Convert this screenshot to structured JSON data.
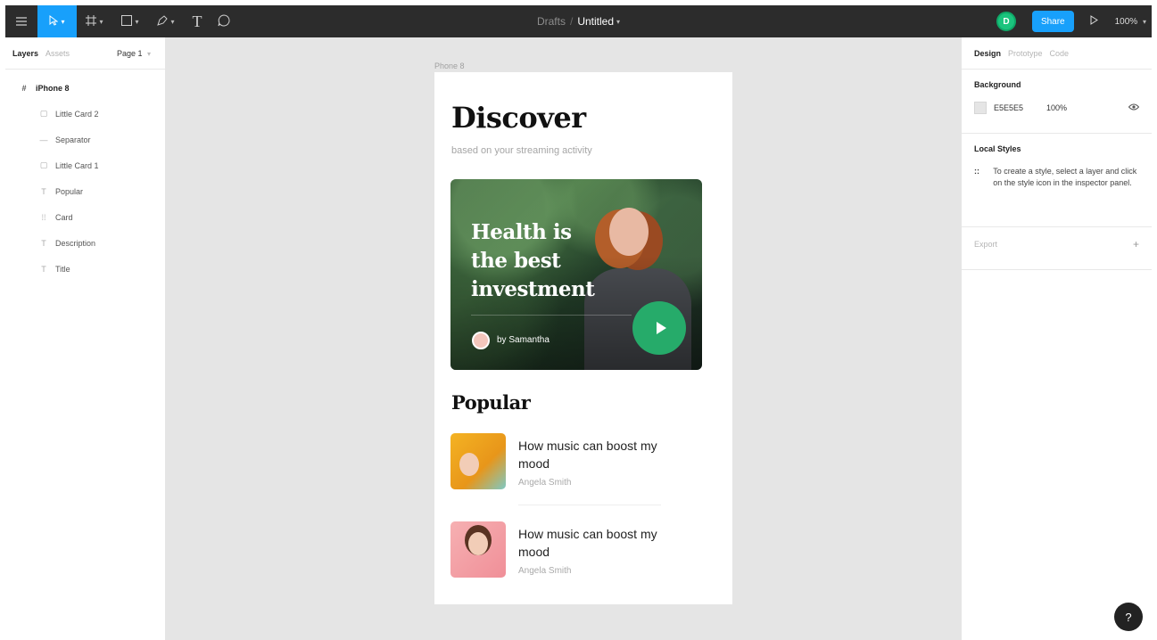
{
  "toolbar": {
    "icons": [
      "menu-icon",
      "move-icon",
      "frame-icon",
      "shape-icon",
      "pen-icon",
      "text-icon",
      "comment-icon"
    ],
    "text_tool_glyph": "T",
    "breadcrumb": {
      "project": "Drafts",
      "separator": "/",
      "file": "Untitled"
    },
    "avatar_initial": "D",
    "share_label": "Share",
    "zoom_label": "100%",
    "accent": "#18a0fb"
  },
  "left_panel": {
    "tabs": {
      "layers": "Layers",
      "assets": "Assets"
    },
    "page_label": "Page 1",
    "root_layer": "iPhone 8",
    "layers": [
      {
        "label": "Little Card 2",
        "icon": "frame-icon"
      },
      {
        "label": "Separator",
        "icon": "line-icon"
      },
      {
        "label": "Little Card 1",
        "icon": "frame-icon"
      },
      {
        "label": "Popular",
        "icon": "text-icon"
      },
      {
        "label": "Card",
        "icon": "grid-icon"
      },
      {
        "label": "Description",
        "icon": "text-icon"
      },
      {
        "label": "Title",
        "icon": "text-icon"
      }
    ]
  },
  "canvas": {
    "background": "#e5e5e5",
    "frame_label": "Phone 8",
    "screen": {
      "title": "Discover",
      "subtitle": "based on your streaming activity",
      "hero": {
        "title": "Health is the best investment",
        "author": "by Samantha",
        "play_color": "#26ab6a"
      },
      "popular_heading": "Popular",
      "cards": [
        {
          "title": "How music can boost my mood",
          "author": "Angela Smith"
        },
        {
          "title": "How music can boost my mood",
          "author": "Angela Smith"
        }
      ]
    }
  },
  "right_panel": {
    "tabs": {
      "design": "Design",
      "prototype": "Prototype",
      "code": "Code"
    },
    "background_heading": "Background",
    "background_hex": "E5E5E5",
    "background_opacity": "100%",
    "local_styles_heading": "Local Styles",
    "local_styles_hint": "To create a style, select a layer and click on the style icon in the inspector panel.",
    "export_label": "Export"
  },
  "help_label": "?"
}
